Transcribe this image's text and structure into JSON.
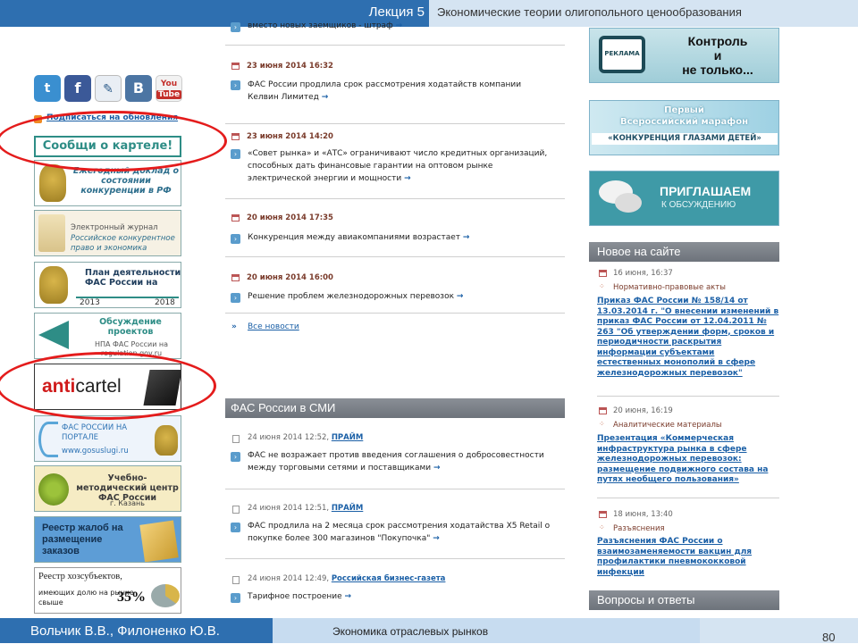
{
  "header": {
    "lecture": "Лекция 5",
    "title": "Экономические теории олигопольного ценообразования"
  },
  "footer": {
    "authors": "Вольчик В.В., Филоненко Ю.В.",
    "course": "Экономика отраслевых рынков",
    "page": "80"
  },
  "social": {
    "icons": [
      "twitter-icon",
      "facebook-icon",
      "livejournal-icon",
      "vkontakte-icon",
      "youtube-icon"
    ],
    "subscribe": "Подписаться на обновления"
  },
  "left_banners": {
    "report_cartel": "Сообщи о картеле!",
    "annual_report": "Ежегодный доклад о состоянии конкуренции в РФ",
    "journal_line1": "Электронный журнал",
    "journal_line2": "Российское конкурентное право и экономика",
    "plan_title": "План деятельности ФАС России на",
    "plan_year_from": "2013",
    "plan_year_to": "2018",
    "discussion": "Обсуждение проектов",
    "discussion_sub": "НПА ФАС России на regulation.gov.ru",
    "anticartel_a": "anti",
    "anticartel_b": "cartel",
    "portal": "ФАС РОССИИ НА ПОРТАЛЕ",
    "portal_url": "www.gosuslugi.ru",
    "center": "Учебно-методический центр ФАС России",
    "center_city": "г. Казань",
    "registry_complaints": "Реестр жалоб на размещение заказов",
    "registry_entities": "Реестр хозсубъектов,",
    "registry_entities_sub": "имеющих долю на рынке свыше",
    "registry_pct": "35%"
  },
  "news": {
    "top_text": "вместо новых заемщиков - штраф",
    "items": [
      {
        "date": "23 июня 2014 16:32",
        "text": "ФАС России продлила срок рассмотрения ходатайств компании Келвин Лимитед"
      },
      {
        "date": "23 июня 2014 14:20",
        "text": "«Совет рынка» и «АТС» ограничивают число кредитных организаций, способных дать финансовые гарантии на оптовом рынке электрической энергии и мощности"
      },
      {
        "date": "20 июня 2014 17:35",
        "text": "Конкуренция между авиакомпаниями возрастает"
      },
      {
        "date": "20 июня 2014 16:00",
        "text": "Решение проблем железнодорожных перевозок"
      }
    ],
    "all_news": "Все новости"
  },
  "media": {
    "heading": "ФАС России в СМИ",
    "items": [
      {
        "date": "24 июня 2014 12:52,",
        "source": "ПРАЙМ",
        "text": "ФАС не возражает против введения соглашения о добросовестности между торговыми сетями и поставщиками"
      },
      {
        "date": "24 июня 2014 12:51,",
        "source": "ПРАЙМ",
        "text": "ФАС продлила на 2 месяца срок рассмотрения ходатайства X5 Retail о покупке более 300 магазинов \"Покупочка\""
      },
      {
        "date": "24 июня 2014 12:49,",
        "source": "Российская бизнес-газета",
        "text": "Тарифное построение"
      }
    ]
  },
  "right": {
    "tv_label": "РЕКЛАМА",
    "control_line1": "Контроль",
    "control_line2": "и",
    "control_line3": "не только...",
    "marathon_line1": "Первый",
    "marathon_line2": "Всероссийский марафон",
    "marathon_line3": "«КОНКУРЕНЦИЯ ГЛАЗАМИ ДЕТЕЙ»",
    "invite_line1": "ПРИГЛАШАЕМ",
    "invite_line2": "К ОБСУЖДЕНИЮ",
    "new_heading": "Новое на сайте",
    "new_items": [
      {
        "date": "16 июня, 16:37",
        "category": "Нормативно-правовые акты",
        "link": "Приказ ФАС России № 158/14 от 13.03.2014 г. \"О внесении изменений в приказ ФАС России от 12.04.2011 № 263 \"Об утверждении форм, сроков и периодичности раскрытия информации субъектами естественных монополий в сфере железнодорожных перевозок\""
      },
      {
        "date": "20 июня, 16:19",
        "category": "Аналитические материалы",
        "link": "Презентация «Коммерческая инфраструктура рынка в сфере железнодорожных перевозок: размещение подвижного состава на путях необщего пользования»"
      },
      {
        "date": "18 июня, 13:40",
        "category": "Разъяснения",
        "link": "Разъяснения ФАС России о взаимозаменяемости вакцин для профилактики пневмококковой инфекции"
      }
    ],
    "qa_heading": "Вопросы и ответы"
  },
  "colors": {
    "header_blue": "#2e6fb0",
    "header_light": "#d5e4f2",
    "link_blue": "#1a5fa6",
    "annotation_red": "#e41c1c",
    "banner_teal": "#2e8d86"
  }
}
